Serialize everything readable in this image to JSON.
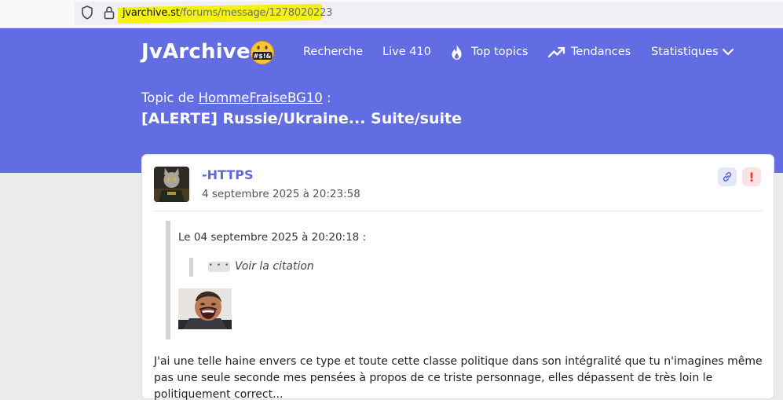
{
  "browser": {
    "url_domain": "jvarchive.st",
    "url_path": "/forums/message/1278020223",
    "icons": [
      "shield-icon",
      "lock-icon"
    ],
    "highlight_color": "#f3f213"
  },
  "site": {
    "logo": "JvArchive",
    "logo_badge": "#$!&",
    "nav": {
      "recherche": "Recherche",
      "live": "Live 410",
      "top_topics": "Top topics",
      "tendances": "Tendances",
      "statistiques": "Statistiques"
    },
    "nav_icons": [
      "fire-icon",
      "trending-icon",
      "chevron-down-icon"
    ],
    "accent_color": "#636de3"
  },
  "topic": {
    "prefix": "Topic de ",
    "author": "HommeFraiseBG10",
    "suffix": " :",
    "title": "[ALERTE] Russie/Ukraine... Suite/suite"
  },
  "message": {
    "author": "-HTTPS",
    "date": "4 septembre 2025 à 20:23:58",
    "actions": [
      "link-icon",
      "report-icon"
    ],
    "report_label": "!",
    "quote": {
      "header": "Le 04 septembre 2025 à 20:20:18 :",
      "dots": "• • •",
      "nested_label": "Voir la citation"
    },
    "body": "J'ai une telle haine envers ce type et toute cette classe politique dans son intégralité que tu n'imagines même pas une seule seconde mes pensées à propos de ce triste personnage, elles dépassent de très loin le politiquement correct..."
  }
}
